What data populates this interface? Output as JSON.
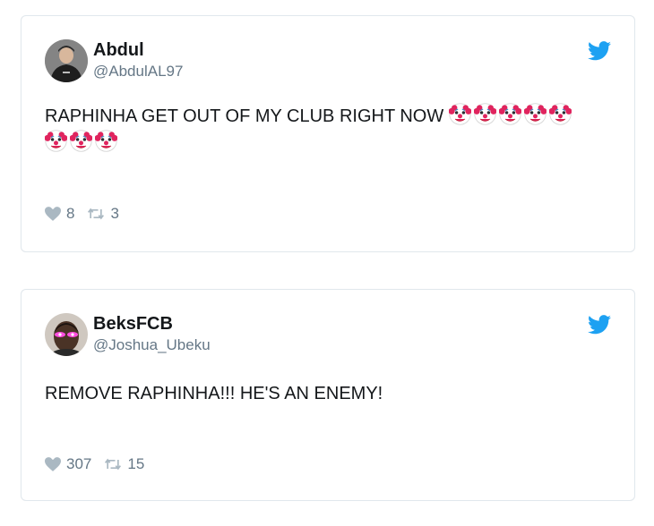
{
  "tweets": [
    {
      "name": "Abdul",
      "handle": "@AbdulAL97",
      "text": "RAPHINHA GET OUT OF MY CLUB RIGHT NOW",
      "emoji_count": 8,
      "emoji_icon": "clown-face-icon",
      "likes": "8",
      "retweets": "3"
    },
    {
      "name": "BeksFCB",
      "handle": "@Joshua_Ubeku",
      "text": "REMOVE RAPHINHA!!! HE'S AN ENEMY!",
      "emoji_count": 0,
      "likes": "307",
      "retweets": "15"
    }
  ],
  "colors": {
    "twitter_blue": "#1da1f2",
    "secondary_text": "#657786",
    "icon_grey": "#aab8c2",
    "border": "#e1e8ed"
  }
}
